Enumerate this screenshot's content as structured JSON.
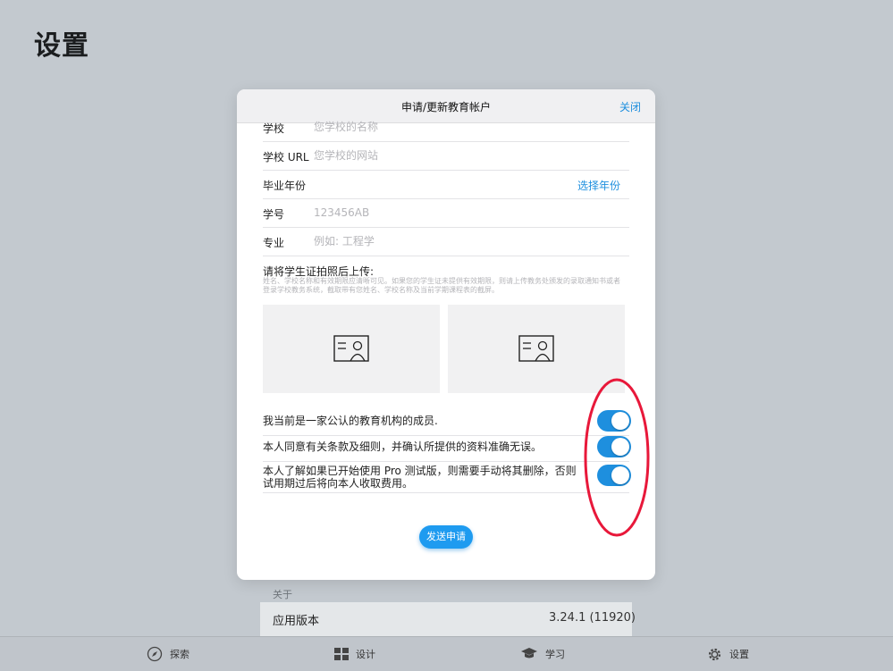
{
  "page_title": "设置",
  "modal": {
    "title": "申请/更新教育帐户",
    "close_label": "关闭",
    "fields": {
      "school": {
        "label": "学校",
        "placeholder": "您学校的名称"
      },
      "school_url": {
        "label": "学校 URL",
        "placeholder": "您学校的网站"
      },
      "graduation_year": {
        "label": "毕业年份",
        "action": "选择年份"
      },
      "student_id": {
        "label": "学号",
        "placeholder": "123456AB"
      },
      "major": {
        "label": "专业",
        "placeholder": "例如: 工程学"
      }
    },
    "upload": {
      "title": "请将学生证拍照后上传:",
      "hint": "姓名、学校名称和有效期限应清晰可见。如果您的学生证未提供有效期限，则请上传教务处颁发的录取通知书或者登录学校教务系统，截取带有您姓名、学校名称及当前学期课程表的截屏。"
    },
    "toggles": [
      {
        "text": "我当前是一家公认的教育机构的成员.",
        "on": true
      },
      {
        "text": "本人同意有关条款及细则，并确认所提供的资料准确无误。",
        "on": true
      },
      {
        "text": "本人了解如果已开始使用 Pro 测试版，则需要手动将其删除，否则试用期过后将向本人收取费用。",
        "on": true
      }
    ],
    "submit_label": "发送申请"
  },
  "about": {
    "section_label": "关于",
    "version_label": "应用版本",
    "version_value": "3.24.1 (11920)"
  },
  "tabbar": {
    "tabs": [
      {
        "label": "探索",
        "icon": "compass-icon"
      },
      {
        "label": "设计",
        "icon": "grid-icon"
      },
      {
        "label": "学习",
        "icon": "graduation-cap-icon"
      },
      {
        "label": "设置",
        "icon": "gear-icon"
      }
    ]
  },
  "colors": {
    "accent": "#1e8fde",
    "annotation": "#e8183a",
    "background": "#c3c9cf"
  }
}
